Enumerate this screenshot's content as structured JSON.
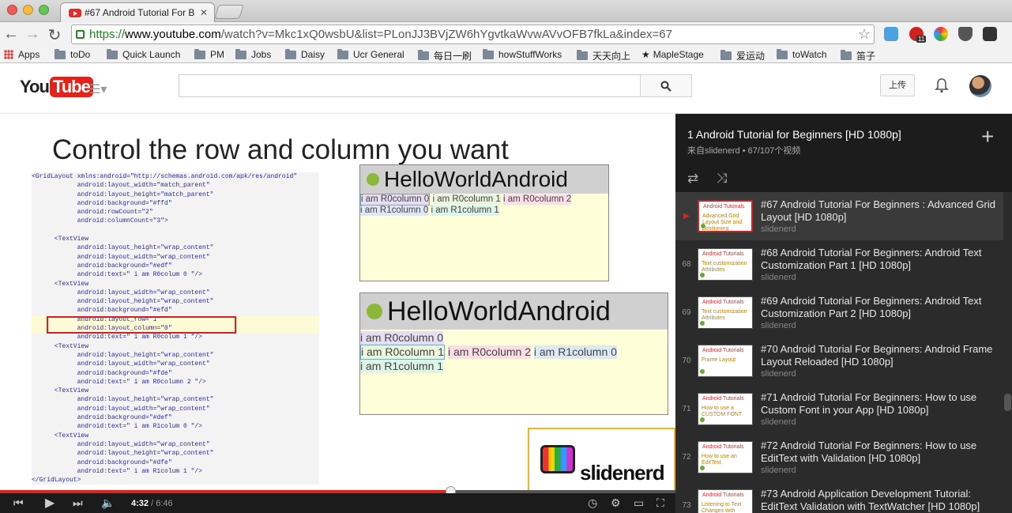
{
  "browser": {
    "tab_title": "#67 Android Tutorial For B",
    "url_scheme": "https://",
    "url_host": "www.youtube.com",
    "url_path": "/watch?v=Mkc1xQ0wsbU&list=PLonJJ3BVjZW6hYgvtkaWvwAVvOFB7fkLa&index=67",
    "ext_badge": "11"
  },
  "bookmarks": [
    "Apps",
    "toDo",
    "Quick Launch",
    "PM",
    "Jobs",
    "Daisy",
    "Ucr General",
    "每日一刷",
    "howStuffWorks",
    "天天向上",
    "MapleStage",
    "爱运动",
    "toWatch",
    "笛子"
  ],
  "youtube": {
    "logo_you": "You",
    "logo_tube": "Tube",
    "upload_label": "上传",
    "search_value": ""
  },
  "slide": {
    "title": "Control the row and column you want",
    "code_lines": [
      "<GridLayout xmlns:android=\"http://schemas.android.com/apk/res/android\"",
      "            android:layout_width=\"match_parent\"",
      "            android:layout_height=\"match_parent\"",
      "            android:background=\"#ffd\"",
      "            android:rowCount=\"2\"",
      "            android:columnCount=\"3\">",
      "",
      "      <TextView",
      "            android:layout_height=\"wrap_content\"",
      "            android:layout_width=\"wrap_content\"",
      "            android:background=\"#edf\"",
      "            android:text=\" i am R0colum 0 \"/>",
      "      <TextView",
      "            android:layout_width=\"wrap_content\"",
      "            android:layout_height=\"wrap_content\"",
      "            android:background=\"#efd\"",
      "            android:layout_row=\"1\"",
      "            android:layout_column=\"0\"",
      "            android:text=\" i am R0colum 1 \"/>",
      "      <TextView",
      "            android:layout_height=\"wrap_content\"",
      "            android:layout_width=\"wrap_content\"",
      "            android:background=\"#fde\"",
      "            android:text=\" i am R0column 2 \"/>",
      "      <TextView",
      "            android:layout_height=\"wrap_content\"",
      "            android:layout_width=\"wrap_content\"",
      "            android:background=\"#def\"",
      "            android:text=\" i am R1colum 0 \"/>",
      "      <TextView",
      "            android:layout_width=\"wrap_content\"",
      "            android:layout_height=\"wrap_content\"",
      "            android:background=\"#dfe\"",
      "            android:text=\" i am R1colum 1 \"/>",
      "</GridLayout>"
    ],
    "app_name": "HelloWorldAndroid",
    "screen1": {
      "row0": [
        "i am R0column 0",
        "i am R0column 1",
        "i am R0column 2"
      ],
      "row1": [
        "i am R1column 0",
        "i am R1column 1"
      ]
    },
    "screen2": {
      "row0": [
        "i am R0column 0"
      ],
      "row1": [
        "i am R0column 1",
        "i am R0column 2",
        "i am R1column 0"
      ],
      "row2": [
        "i am R1column 1"
      ]
    },
    "watermark": "slidenerd"
  },
  "player": {
    "current_time": "4:32",
    "duration": "/ 6:46",
    "progress_fraction": 0.667
  },
  "playlist": {
    "title": "1 Android Tutorial for Beginners [HD 1080p]",
    "subtitle": "来自slidenerd • 67/107个视频",
    "items": [
      {
        "num": "▶",
        "title": "#67 Android Tutorial For Beginners : Advanced Grid Layout [HD 1080p]",
        "channel": "slidenerd",
        "thumb_top": "Android Tutorials",
        "thumb_text": "Advanced Grid Layout Size and positioning"
      },
      {
        "num": "68",
        "title": "#68 Android Tutorial For Beginners: Android Text Customization Part 1 [HD 1080p]",
        "channel": "slidenerd",
        "thumb_top": "Android Tutorials",
        "thumb_text": "Text customization Attributes"
      },
      {
        "num": "69",
        "title": "#69 Android Tutorial For Beginners: Android Text Customization Part 2 [HD 1080p]",
        "channel": "slidenerd",
        "thumb_top": "Android Tutorials",
        "thumb_text": "Text customization Attributes"
      },
      {
        "num": "70",
        "title": "#70 Android Tutorial For Beginners: Android Frame Layout Reloaded [HD 1080p]",
        "channel": "slidenerd",
        "thumb_top": "Android Tutorials",
        "thumb_text": "Frame Layout"
      },
      {
        "num": "71",
        "title": "#71 Android Tutorial For Beginners: How to use Custom Font in your App [HD 1080p]",
        "channel": "slidenerd",
        "thumb_top": "Android Tutorials",
        "thumb_text": "How to use a CUSTOM FONT"
      },
      {
        "num": "72",
        "title": "#72 Android Tutorial For Beginners: How to use EditText with Validation [HD 1080p]",
        "channel": "slidenerd",
        "thumb_top": "Android Tutorials",
        "thumb_text": "How to use an EditText"
      },
      {
        "num": "73",
        "title": "#73 Android Application Development Tutorial: EditText Validation with TextWatcher [HD 1080p]",
        "channel": "slidenerd",
        "thumb_top": "Android Tutorials",
        "thumb_text": "Listening to Text Changes with"
      }
    ]
  }
}
